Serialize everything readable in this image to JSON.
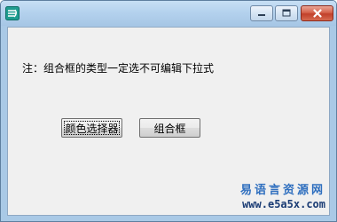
{
  "window": {
    "title": "",
    "controls": {
      "minimize_icon": "minimize-icon",
      "maximize_icon": "maximize-icon",
      "close_icon": "close-icon"
    }
  },
  "content": {
    "note_text": "注：组合框的类型一定选不可编辑下拉式",
    "buttons": {
      "color_picker_label": "颜色选择器",
      "combo_box_label": "组合框"
    }
  },
  "watermark": {
    "title": "易语言资源网",
    "url": "www.e5a5x.com"
  },
  "colors": {
    "title_bar": "#b3d1ed",
    "client_bg": "#f0f0f0",
    "close_button": "#c1402a",
    "watermark_title": "#2f6fbf",
    "watermark_url": "#1b3c74"
  }
}
